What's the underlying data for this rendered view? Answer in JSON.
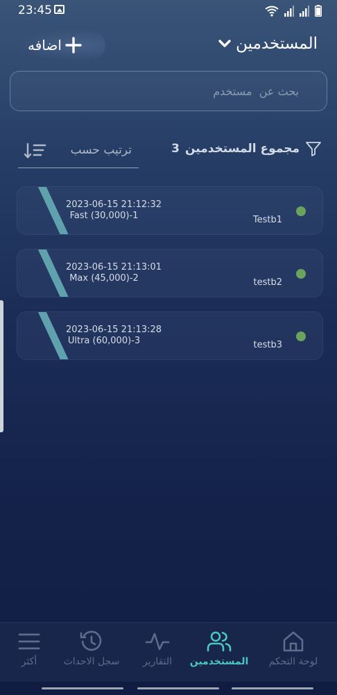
{
  "status_bar": {
    "time": "23:45",
    "icons": [
      "image-icon",
      "wifi-icon",
      "signal-icon",
      "signal-icon",
      "battery-icon"
    ]
  },
  "header": {
    "title": "المستخدمين",
    "title_icon": "chevron-down-icon",
    "add_label": "اضافه",
    "add_icon": "plus-icon"
  },
  "search": {
    "placeholder": "بحث عن  مستخدم",
    "value": ""
  },
  "filter": {
    "total_label": "مجموع المستخدمين",
    "total_count": "3",
    "filter_icon": "filter-icon",
    "sort_label": "ترتيب حسب",
    "sort_icon": "sort-icon"
  },
  "users": [
    {
      "date": "2023-06-15 21:12:32",
      "plan": "Fast (30,000)-1",
      "name": "Testb1",
      "status_color": "#6aa35e"
    },
    {
      "date": "2023-06-15 21:13:01",
      "plan": "Max (45,000)-2",
      "name": "testb2",
      "status_color": "#6aa35e"
    },
    {
      "date": "2023-06-15 21:13:28",
      "plan": "Ultra (60,000)-3",
      "name": "testb3",
      "status_color": "#6aa35e"
    }
  ],
  "bottom_nav": {
    "items": [
      {
        "label": "لوحة التحكم",
        "icon": "home-icon",
        "active": false
      },
      {
        "label": "المستخدمين",
        "icon": "users-icon",
        "active": true
      },
      {
        "label": "التقارير",
        "icon": "activity-icon",
        "active": false
      },
      {
        "label": "سجل الاحداث",
        "icon": "history-icon",
        "active": false
      },
      {
        "label": "أكثر",
        "icon": "menu-icon",
        "active": false
      }
    ]
  },
  "colors": {
    "accent": "#49c7c0",
    "card_stripe": "#5fa2ad",
    "status_online": "#6aa35e",
    "inactive_nav": "#5d6c8a"
  }
}
